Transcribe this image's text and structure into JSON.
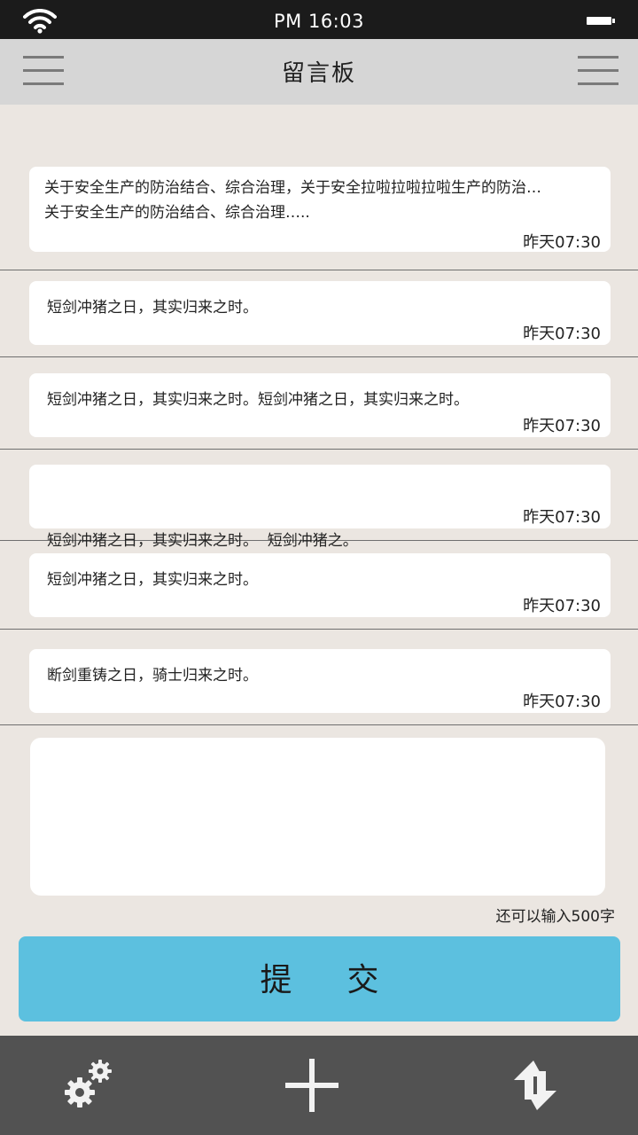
{
  "status_bar": {
    "time": "PM 16:03",
    "icons": [
      "wifi-icon",
      "battery-icon"
    ]
  },
  "nav": {
    "title": "留言板",
    "left_icon": "menu-icon",
    "right_icon": "menu-icon"
  },
  "messages": [
    {
      "lines": [
        "关于安全生产的防治结合、综合治理，关于安全拉啦拉啦拉啦生产的防治…",
        "关于安全生产的防治结合、综合治理….."
      ],
      "time": "昨天07:30"
    },
    {
      "lines": [
        "短剑冲猪之日，其实归来之时。"
      ],
      "time": "昨天07:30"
    },
    {
      "lines": [
        "短剑冲猪之日，其实归来之时。短剑冲猪之日，其实归来之时。"
      ],
      "time": "昨天07:30"
    },
    {
      "lines": [
        "短剑冲猪之日，其实归来之时。  短剑冲猪之。"
      ],
      "time": "昨天07:30"
    },
    {
      "lines": [
        "短剑冲猪之日，其实归来之时。"
      ],
      "time": "昨天07:30"
    },
    {
      "lines": [
        "断剑重铸之日，骑士归来之时。"
      ],
      "time": "昨天07:30"
    }
  ],
  "compose": {
    "value": "",
    "placeholder": "",
    "remaining_label": "还可以输入500字"
  },
  "submit_label": "提 交",
  "tab_bar": {
    "items": [
      "settings-gears-icon",
      "add-plus-icon",
      "refresh-sync-icon"
    ]
  },
  "colors": {
    "status_bg": "#1b1b1b",
    "nav_bg": "#d6d6d6",
    "page_bg": "#ebe6e1",
    "accent": "#5cc0df",
    "tab_bg": "#525252"
  }
}
